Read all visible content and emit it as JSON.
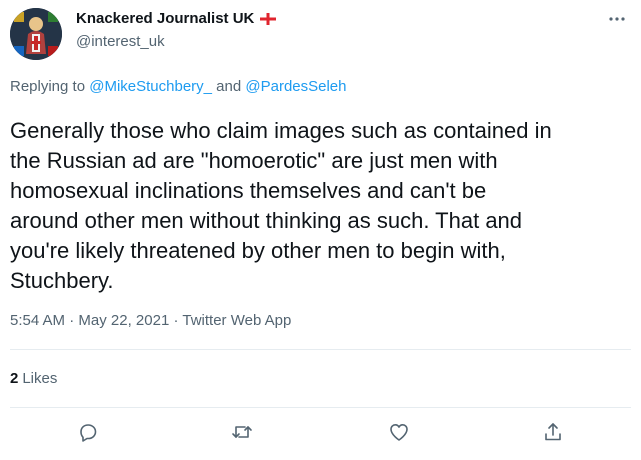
{
  "tweet": {
    "display_name": "Knackered Journalist UK",
    "handle": "@interest_uk",
    "replying_prefix": "Replying to",
    "replying_user_1": "@MikeStuchbery_",
    "replying_and": "and",
    "replying_user_2": "@PardesSeleh",
    "text": "Generally those who claim images such as contained in\nthe Russian ad are \"homoerotic\" are just men with\nhomosexual inclinations themselves and can't be\naround other men without thinking as such. That and\nyou're likely threatened by other men to begin with,\nStuchbery.",
    "time": "5:54 AM",
    "date": "May 22, 2021",
    "client": "Twitter Web App",
    "likes_count": "2",
    "likes_label": "Likes"
  },
  "icons": {
    "more": "more-horizontal-icon",
    "reply": "reply-icon",
    "retweet": "retweet-icon",
    "like": "heart-icon",
    "share": "share-icon",
    "flag": "england-flag-icon"
  },
  "colors": {
    "text": "#0f1419",
    "secondary": "#536471",
    "link": "#1d9bf0",
    "divider": "#e6ecf0",
    "flag_red": "#e0242e"
  }
}
